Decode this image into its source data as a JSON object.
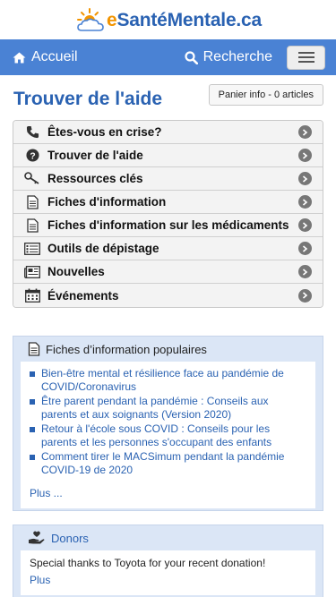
{
  "header": {
    "logo_prefix": "e",
    "logo_main": "SantéMentale.ca"
  },
  "nav": {
    "home_label": "Accueil",
    "search_label": "Recherche"
  },
  "page": {
    "title": "Trouver de l'aide",
    "cart_label": "Panier info - 0 articles"
  },
  "menu": {
    "items": [
      {
        "label": "Êtes-vous en crise?",
        "icon": "phone-icon"
      },
      {
        "label": "Trouver de l'aide",
        "icon": "question-circle-icon"
      },
      {
        "label": "Ressources clés",
        "icon": "key-icon"
      },
      {
        "label": "Fiches d'information",
        "icon": "document-icon"
      },
      {
        "label": "Fiches d'information sur les médicaments",
        "icon": "document-icon"
      },
      {
        "label": "Outils de dépistage",
        "icon": "list-icon"
      },
      {
        "label": "Nouvelles",
        "icon": "newspaper-icon"
      },
      {
        "label": "Événements",
        "icon": "calendar-icon"
      }
    ]
  },
  "popular": {
    "title": "Fiches d’information populaires",
    "items": [
      "Bien-être mental et résilience face au pandémie de COVID/Coronavirus",
      "Être parent pendant la pandémie : Conseils aux parents et aux soignants (Version 2020)",
      "Retour à l'école sous COVID : Conseils pour les parents et les personnes s'occupant des enfants",
      "Comment tirer le MACSimum pendant la pandémie COVID-19 de 2020"
    ],
    "more_label": "Plus ..."
  },
  "donors": {
    "title": "Donors",
    "text": "Special thanks to Toyota for your recent donation!",
    "more_label": "Plus"
  },
  "colors": {
    "brand_blue": "#2a62b2",
    "nav_blue": "#4a82d4",
    "accent_orange": "#f29400"
  }
}
